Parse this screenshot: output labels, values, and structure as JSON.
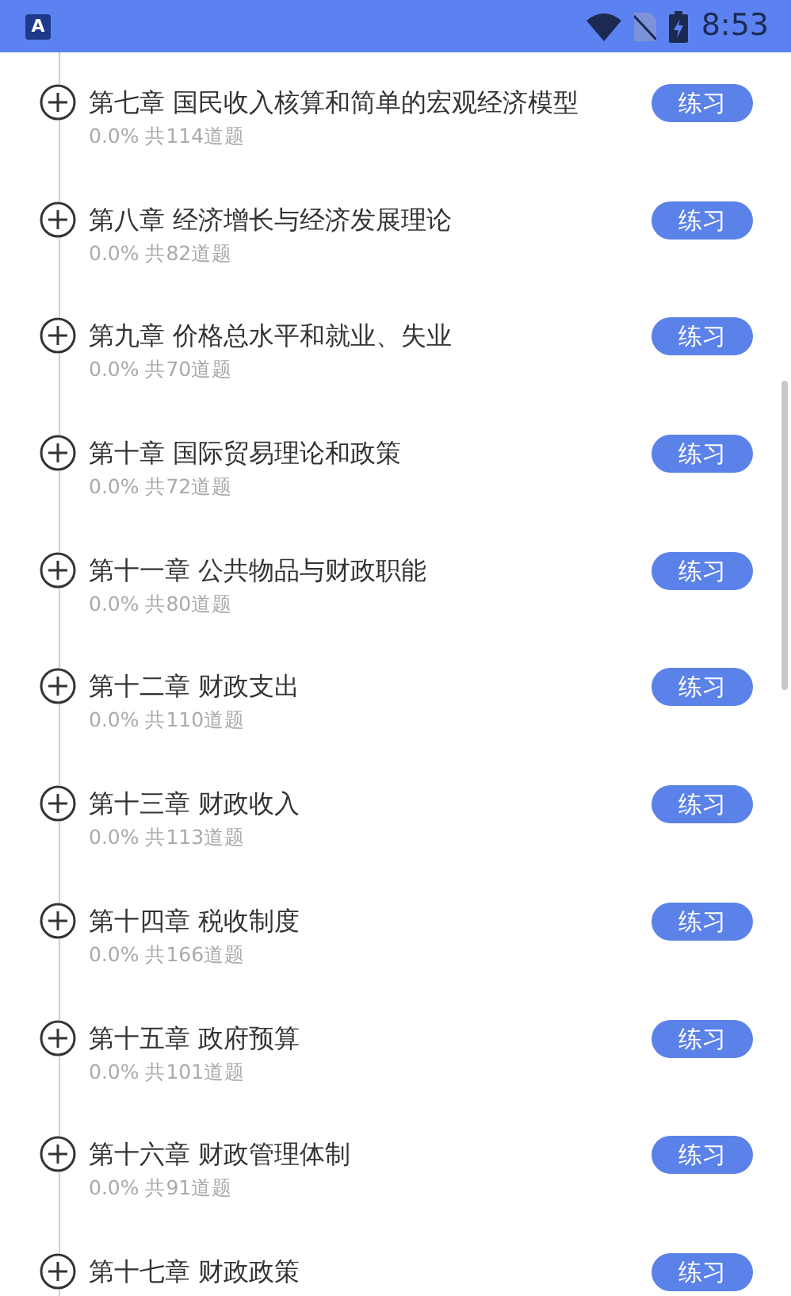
{
  "status_bar": {
    "notification_icon": "A",
    "time": "8:53"
  },
  "chapters": [
    {
      "title": "第七章 国民收入核算和简单的宏观经济模型",
      "progress": "0.0%",
      "count": "共114道题",
      "button": "练习"
    },
    {
      "title": "第八章 经济增长与经济发展理论",
      "progress": "0.0%",
      "count": "共82道题",
      "button": "练习"
    },
    {
      "title": "第九章 价格总水平和就业、失业",
      "progress": "0.0%",
      "count": "共70道题",
      "button": "练习"
    },
    {
      "title": "第十章 国际贸易理论和政策",
      "progress": "0.0%",
      "count": "共72道题",
      "button": "练习"
    },
    {
      "title": "第十一章 公共物品与财政职能",
      "progress": "0.0%",
      "count": "共80道题",
      "button": "练习"
    },
    {
      "title": "第十二章 财政支出",
      "progress": "0.0%",
      "count": "共110道题",
      "button": "练习"
    },
    {
      "title": "第十三章 财政收入",
      "progress": "0.0%",
      "count": "共113道题",
      "button": "练习"
    },
    {
      "title": "第十四章 税收制度",
      "progress": "0.0%",
      "count": "共166道题",
      "button": "练习"
    },
    {
      "title": "第十五章 政府预算",
      "progress": "0.0%",
      "count": "共101道题",
      "button": "练习"
    },
    {
      "title": "第十六章 财政管理体制",
      "progress": "0.0%",
      "count": "共91道题",
      "button": "练习"
    },
    {
      "title": "第十七章 财政政策",
      "button": "练习"
    }
  ]
}
